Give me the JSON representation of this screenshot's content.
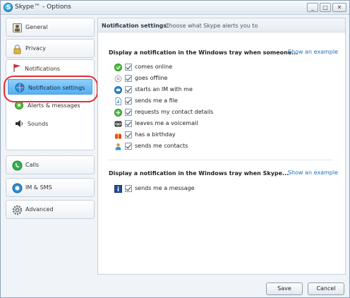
{
  "window": {
    "title": "Skype™ - Options",
    "controls": [
      "_",
      "□",
      "✕"
    ]
  },
  "sidebar": {
    "general": "General",
    "privacy": "Privacy",
    "notifications": "Notifications",
    "sub": [
      {
        "label": "Notification settings",
        "icon": "skype-globe-icon",
        "selected": true
      },
      {
        "label": "Alerts & messages",
        "icon": "alert-icon",
        "selected": false
      },
      {
        "label": "Sounds",
        "icon": "speaker-icon",
        "selected": false
      }
    ],
    "calls": "Calls",
    "im_sms": "IM & SMS",
    "advanced": "Advanced"
  },
  "main": {
    "header_title": "Notification settings:",
    "header_sub": "Choose what Skype alerts you to",
    "section1": {
      "title": "Display a notification in the Windows tray when someone...",
      "link": "Show an example",
      "options": [
        {
          "label": "comes online",
          "checked": true,
          "icon": "online-status-icon"
        },
        {
          "label": "goes offline",
          "checked": true,
          "icon": "offline-status-icon"
        },
        {
          "label": "starts an IM with me",
          "checked": true,
          "icon": "chat-icon"
        },
        {
          "label": "sends me a file",
          "checked": true,
          "icon": "file-icon"
        },
        {
          "label": "requests my contact details",
          "checked": true,
          "icon": "contact-request-icon"
        },
        {
          "label": "leaves me a voicemail",
          "checked": true,
          "icon": "voicemail-icon"
        },
        {
          "label": "has a birthday",
          "checked": true,
          "icon": "birthday-icon"
        },
        {
          "label": "sends me contacts",
          "checked": true,
          "icon": "contacts-icon"
        }
      ]
    },
    "section2": {
      "title": "Display a notification in the Windows tray when Skype...",
      "link": "Show an example",
      "options": [
        {
          "label": "sends me a message",
          "checked": true,
          "icon": "info-icon"
        }
      ]
    }
  },
  "footer": {
    "save": "Save",
    "cancel": "Cancel"
  },
  "colors": {
    "selected_bg": "#55aef0",
    "link": "#1f6fc0",
    "highlight_ring": "#e0303a"
  }
}
